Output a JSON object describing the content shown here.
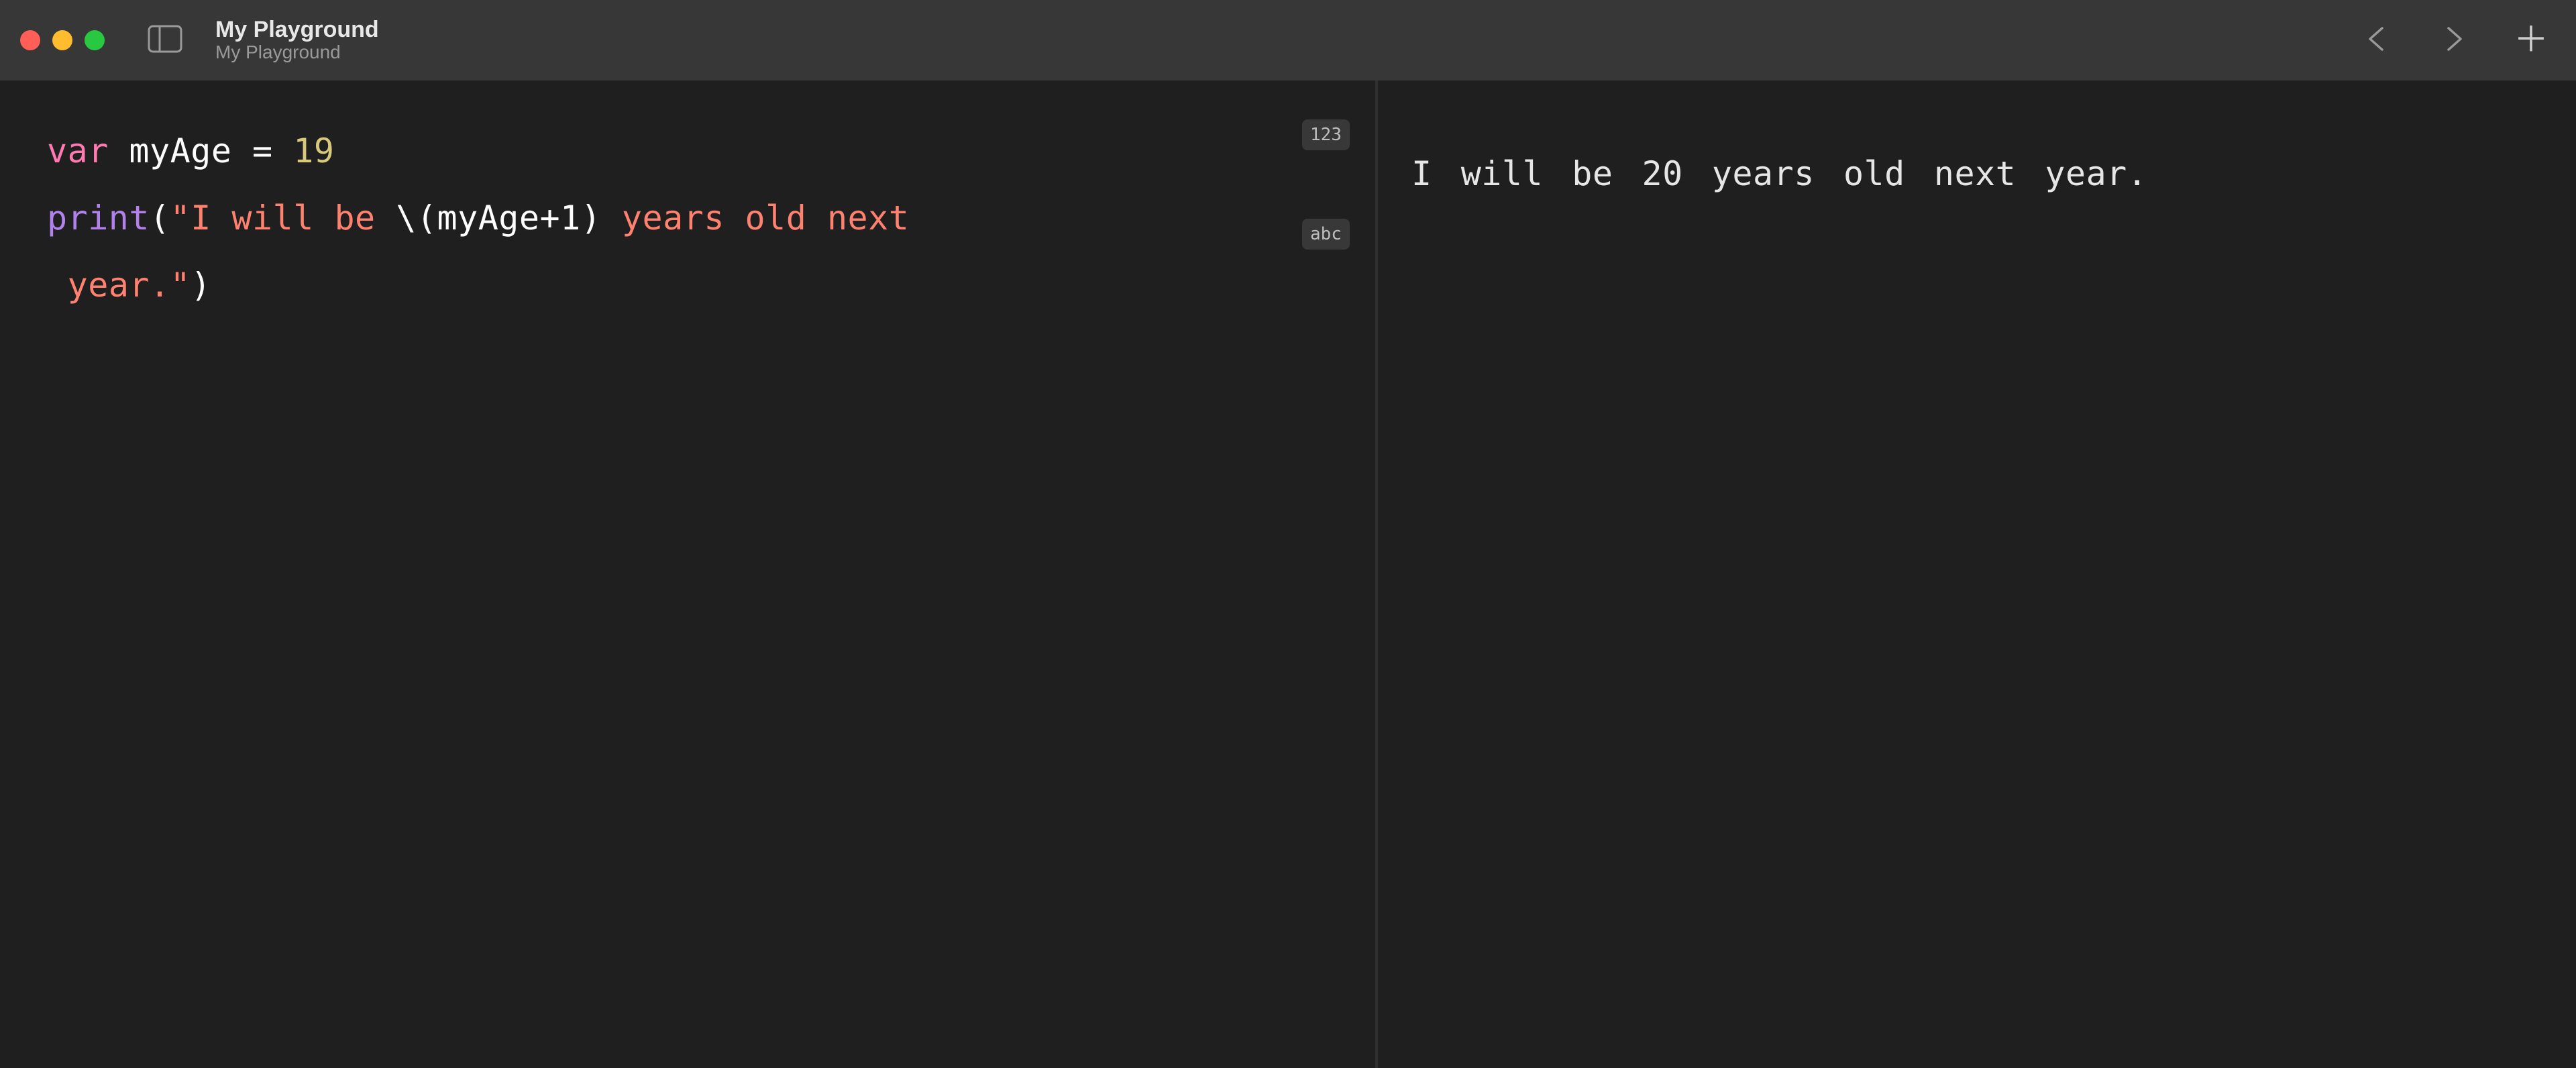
{
  "titlebar": {
    "title": "My Playground",
    "subtitle": "My Playground"
  },
  "code": {
    "line1": {
      "keyword": "var",
      "ident": " myAge = ",
      "number": "19"
    },
    "line2": {
      "func": "print",
      "open": "(",
      "str_open": "\"I will be ",
      "interp_open": "\\(",
      "interp_body": "myAge+1",
      "interp_close": ")",
      "str_mid": " years old next",
      "str_end": " year.\"",
      "close": ")"
    }
  },
  "result_badges": {
    "b1": "123",
    "b2": "abc"
  },
  "output": {
    "text": "I will be 20 years old next year."
  }
}
